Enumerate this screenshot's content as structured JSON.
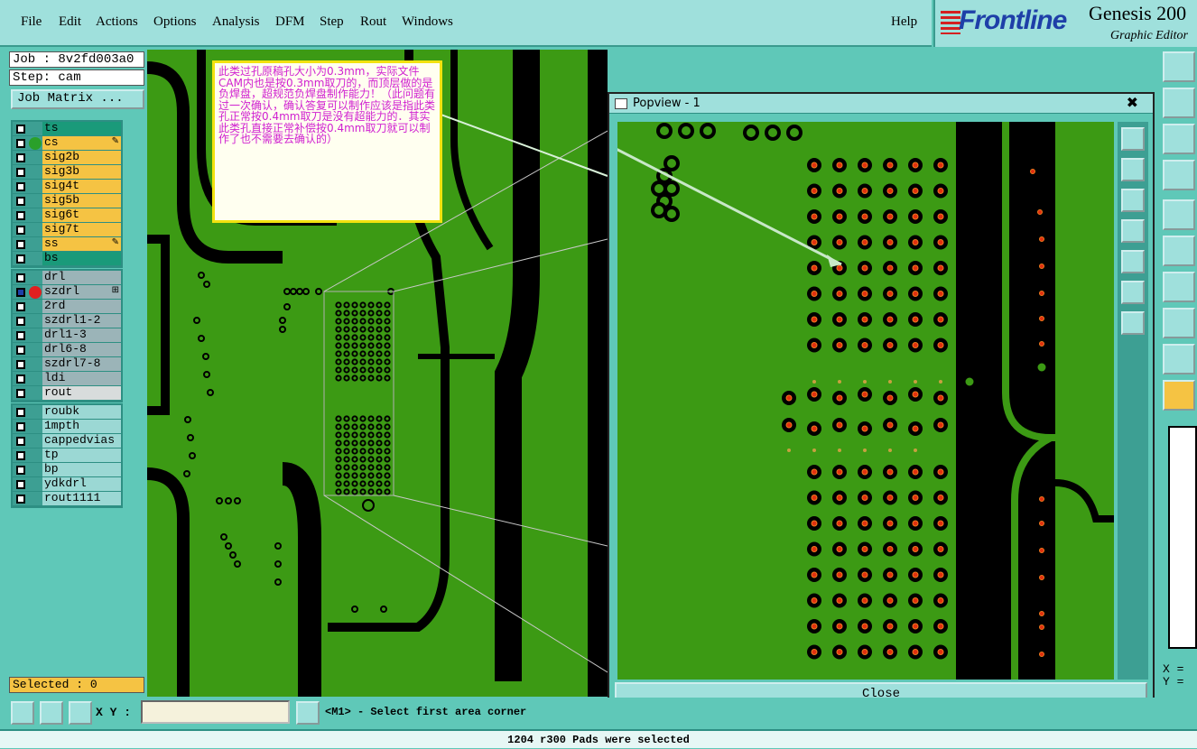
{
  "menu": [
    {
      "label": "File"
    },
    {
      "label": "Edit"
    },
    {
      "label": "Actions"
    },
    {
      "label": "Options"
    },
    {
      "label": "Analysis"
    },
    {
      "label": "DFM"
    },
    {
      "label": "Step"
    },
    {
      "label": "Rout"
    },
    {
      "label": "Windows"
    }
  ],
  "help_label": "Help",
  "logo": {
    "brand": "Frontline",
    "product": "Genesis 200",
    "editor": "Graphic Editor"
  },
  "job": {
    "job_label": "Job : 8v2fd003a0",
    "step_label": "Step: cam",
    "matrix_button": "Job Matrix ..."
  },
  "layers_board": [
    {
      "name": "ts",
      "color": "#1a9a7a",
      "dot": ""
    },
    {
      "name": "cs",
      "color": "#f5c343",
      "dot": "#2aa02a",
      "mark": "✎"
    },
    {
      "name": "sig2b",
      "color": "#f5c343",
      "dot": ""
    },
    {
      "name": "sig3b",
      "color": "#f5c343",
      "dot": ""
    },
    {
      "name": "sig4t",
      "color": "#f5c343",
      "dot": ""
    },
    {
      "name": "sig5b",
      "color": "#f5c343",
      "dot": ""
    },
    {
      "name": "sig6t",
      "color": "#f5c343",
      "dot": ""
    },
    {
      "name": "sig7t",
      "color": "#f5c343",
      "dot": ""
    },
    {
      "name": "ss",
      "color": "#f5c343",
      "dot": "",
      "mark": "✎"
    },
    {
      "name": "bs",
      "color": "#1a9a7a",
      "dot": ""
    }
  ],
  "layers_drill": [
    {
      "name": "drl",
      "color": "#9bb4b8",
      "dot": ""
    },
    {
      "name": "szdrl",
      "color": "#9bb4b8",
      "dot": "#e02020",
      "checked": true,
      "mark": "⊞"
    },
    {
      "name": "2rd",
      "color": "#9bb4b8",
      "dot": ""
    },
    {
      "name": "szdrl1-2",
      "color": "#9bb4b8",
      "dot": ""
    },
    {
      "name": "drl1-3",
      "color": "#9bb4b8",
      "dot": ""
    },
    {
      "name": "drl6-8",
      "color": "#9bb4b8",
      "dot": ""
    },
    {
      "name": "szdrl7-8",
      "color": "#9bb4b8",
      "dot": ""
    },
    {
      "name": "ldi",
      "color": "#9bb4b8",
      "dot": ""
    },
    {
      "name": "rout",
      "color": "#d8dcdc",
      "dot": ""
    }
  ],
  "layers_misc": [
    {
      "name": "roubk",
      "color": "#9bd8d4",
      "dot": ""
    },
    {
      "name": "1mpth",
      "color": "#9bd8d4",
      "dot": ""
    },
    {
      "name": "cappedvias",
      "color": "#9bd8d4",
      "dot": ""
    },
    {
      "name": "tp",
      "color": "#9bd8d4",
      "dot": ""
    },
    {
      "name": "bp",
      "color": "#9bd8d4",
      "dot": ""
    },
    {
      "name": "ydkdrl",
      "color": "#9bd8d4",
      "dot": ""
    },
    {
      "name": "rout1111",
      "color": "#9bd8d4",
      "dot": ""
    }
  ],
  "selected_label": "Selected : 0",
  "annotation": "此类过孔原稿孔大小为0.3mm，实际文件CAM内也是按0.3mm取刀的，而顶层做的是负焊盘，超规范负焊盘制作能力！（此问题有过一次确认，确认答复可以制作应该是指此类孔正常按0.4mm取刀是没有超能力的．其实此类孔直接正常补偿按0.4mm取刀就可以制作了也不需要去确认的）",
  "popview": {
    "title": "Popview - 1",
    "close_label": "Close",
    "close_x": "✖"
  },
  "xy": {
    "label": "X Y :",
    "value": "",
    "readout_x": "X =",
    "readout_y": "Y ="
  },
  "prompt": "<M1> - Select first area corner",
  "status": "1204 r300 Pads were selected",
  "colors": {
    "copper": "#3c9a14",
    "board": "#000000",
    "pad": "#f07a1e",
    "pad_center": "#e03010",
    "annotation_text": "#d020d0"
  }
}
